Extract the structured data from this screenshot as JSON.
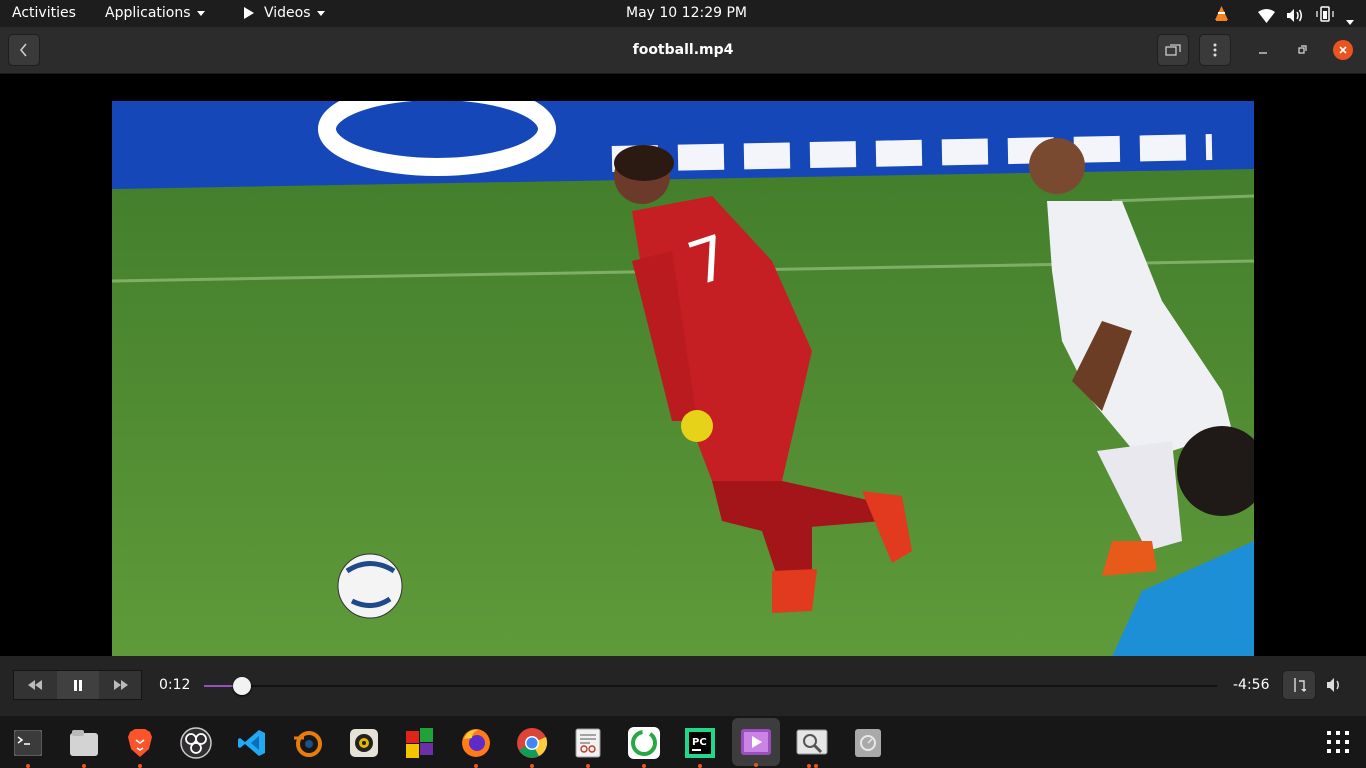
{
  "topbar": {
    "activities": "Activities",
    "applications": "Applications",
    "app_menu": "Videos",
    "clock": "May 10  12:29 PM"
  },
  "header": {
    "title": "football.mp4"
  },
  "video": {
    "jersey_number": "7"
  },
  "player": {
    "elapsed": "0:12",
    "remaining": "-4:56",
    "progress": 0.038
  },
  "colors": {
    "accent": "#e95420",
    "progress": "#9b4fbf"
  },
  "dock": {
    "apps": [
      {
        "name": "terminal-icon",
        "running": true
      },
      {
        "name": "files-icon",
        "running": true
      },
      {
        "name": "brave-icon",
        "running": true
      },
      {
        "name": "obs-icon",
        "running": false
      },
      {
        "name": "vscode-icon",
        "running": false
      },
      {
        "name": "blender-icon",
        "running": false
      },
      {
        "name": "rhythmbox-icon",
        "running": false
      },
      {
        "name": "color-app-icon",
        "running": false
      },
      {
        "name": "firefox-icon",
        "running": true
      },
      {
        "name": "chrome-icon",
        "running": true
      },
      {
        "name": "document-viewer-icon",
        "running": true
      },
      {
        "name": "budgie-icon",
        "running": true
      },
      {
        "name": "pycharm-icon",
        "running": true
      },
      {
        "name": "videos-icon",
        "running": true
      },
      {
        "name": "image-viewer-icon",
        "running": true
      },
      {
        "name": "disk-icon",
        "running": false
      }
    ]
  }
}
